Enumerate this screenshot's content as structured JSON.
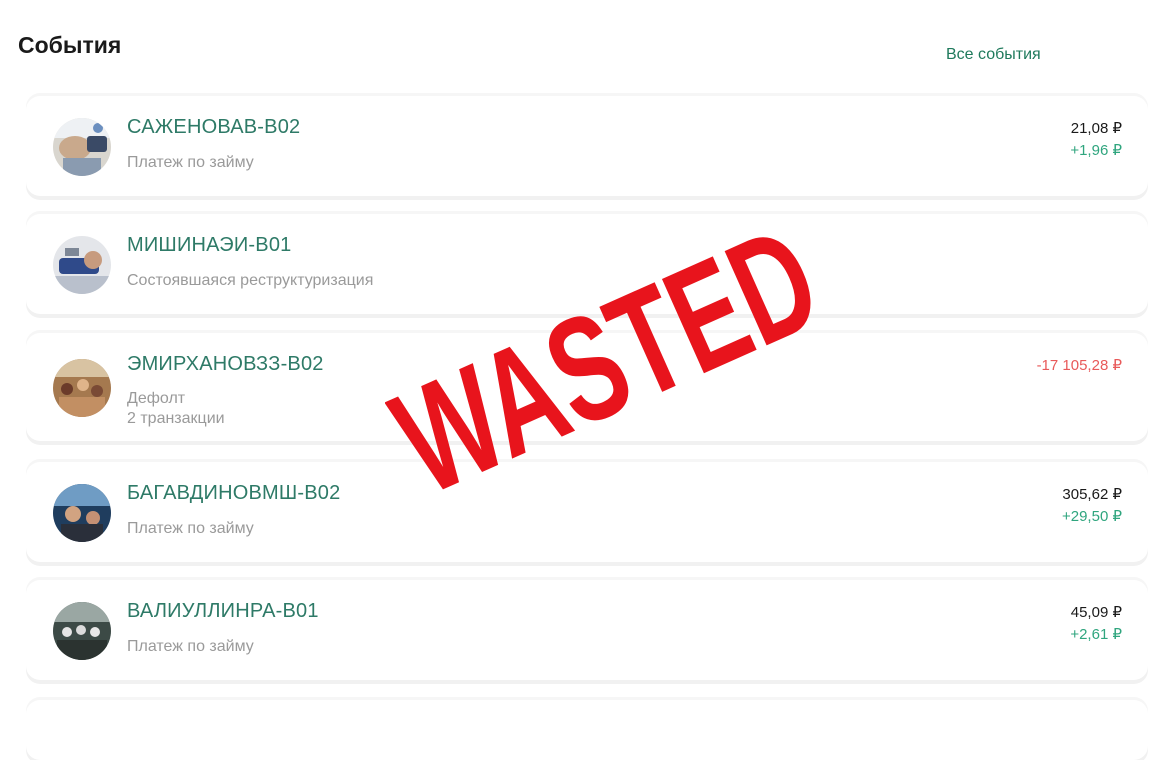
{
  "header": {
    "title": "События",
    "all_events_link": "Все события"
  },
  "events": [
    {
      "name": "САЖЕНОВАВ-В02",
      "description": "Платеж по займу",
      "amount": "21,08 ₽",
      "change": "+1,96 ₽",
      "avatar": "photo-thumbnail"
    },
    {
      "name": "МИШИНАЭИ-В01",
      "description": "Состоявшаяся реструктуризация",
      "avatar": "photo-thumbnail"
    },
    {
      "name": "ЭМИРХАНОВЗЗ-В02",
      "description": "Дефолт",
      "description_2": "2 транзакции",
      "amount": "-17 105,28 ₽",
      "avatar": "photo-thumbnail"
    },
    {
      "name": "БАГАВДИНОВМШ-В02",
      "description": "Платеж по займу",
      "amount": "305,62 ₽",
      "change": "+29,50 ₽",
      "avatar": "photo-thumbnail"
    },
    {
      "name": "ВАЛИУЛЛИНРА-В01",
      "description": "Платеж по займу",
      "amount": "45,09 ₽",
      "change": "+2,61 ₽",
      "avatar": "photo-thumbnail"
    }
  ],
  "overlay": {
    "stamp_text": "WASTED",
    "stamp_color": "#e8141c"
  },
  "colors": {
    "accent": "#2e7a67",
    "positive": "#2fa57e",
    "negative": "#e85a5a",
    "muted": "#9a9a9a"
  }
}
